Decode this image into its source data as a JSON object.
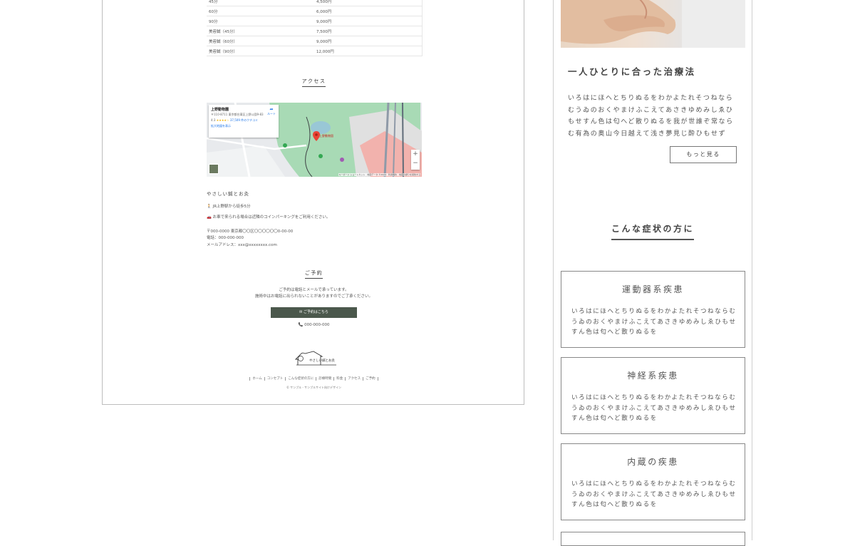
{
  "price_table": [
    {
      "item": "45分",
      "price": "4,500円"
    },
    {
      "item": "60分",
      "price": "6,000円"
    },
    {
      "item": "90分",
      "price": "9,000円"
    },
    {
      "item": "美容鍼（45分）",
      "price": "7,500円"
    },
    {
      "item": "美容鍼（60分）",
      "price": "9,000円"
    },
    {
      "item": "美容鍼（90分）",
      "price": "12,000円"
    }
  ],
  "access": {
    "title": "アクセス",
    "map": {
      "place_name": "上野動物園",
      "address": "〒110-8711 東京都台東区上野公園9-83",
      "rating": "4.3",
      "stars": "★★★★☆",
      "reviews": "37,509 件のクチコミ",
      "enlarge_link": "拡大地図を表示",
      "route_label": "ルート",
      "pin_label": "上野動物園",
      "footer": "キーボード ショートカット　地図データ ©2024　利用規約　地図の誤りを報告する"
    },
    "name": "やさしい鍼とお灸",
    "walk": "🚶 JR上野駅から徒歩5分",
    "car": "🚗 お車で来られる場合は近隣のコインパーキングをご利用ください。",
    "address": "〒000-0000 東京都〇〇区〇〇〇〇〇〇0-00-00",
    "phone": "電話：000-000-000",
    "email": "メールアドレス：xxx@xxxxxxxx.com"
  },
  "reservation": {
    "title": "ご予約",
    "line1": "ご予約は電話とメールで承っています。",
    "line2": "施術中はお電話に出られないことがありますのでご了承ください。",
    "button": "✉ ご予約はこちら",
    "phone": "📞 000-000-000"
  },
  "footer": {
    "logo_text": "やさしい鍼とお灸",
    "nav": [
      "ホーム",
      "コンセプト",
      "こんな症状の方に",
      "診療時間",
      "料金",
      "アクセス",
      "ご予約"
    ],
    "copyright": "© サンプル - サンプルサイト向けデザイン"
  },
  "sidebar": {
    "care_title": "一人ひとりに合った治療法",
    "care_body": "いろはにほへとちりぬるをわかよたれそつねならむうゐのおくやまけふこえてあさきゆめみしゑひもせすん色は匂へど散りぬるを我が世誰ぞ常ならむ有為の奥山今日越えて浅き夢見じ酔ひもせず",
    "more_button": "もっと見る",
    "symptoms_heading": "こんな症状の方に",
    "cards": [
      {
        "title": "運動器系疾患",
        "body": "いろはにほへとちりぬるをわかよたれそつねならむうゐのおくやまけふこえてあさきゆめみしゑひもせすん色は匂へど散りぬるを"
      },
      {
        "title": "神経系疾患",
        "body": "いろはにほへとちりぬるをわかよたれそつねならむうゐのおくやまけふこえてあさきゆめみしゑひもせすん色は匂へど散りぬるを"
      },
      {
        "title": "内蔵の疾患",
        "body": "いろはにほへとちりぬるをわかよたれそつねならむうゐのおくやまけふこえてあさきゆめみしゑひもせすん色は匂へど散りぬるを"
      }
    ]
  },
  "colors": {
    "button_bg": "#4b584c",
    "border": "#888888",
    "text": "#555555"
  }
}
